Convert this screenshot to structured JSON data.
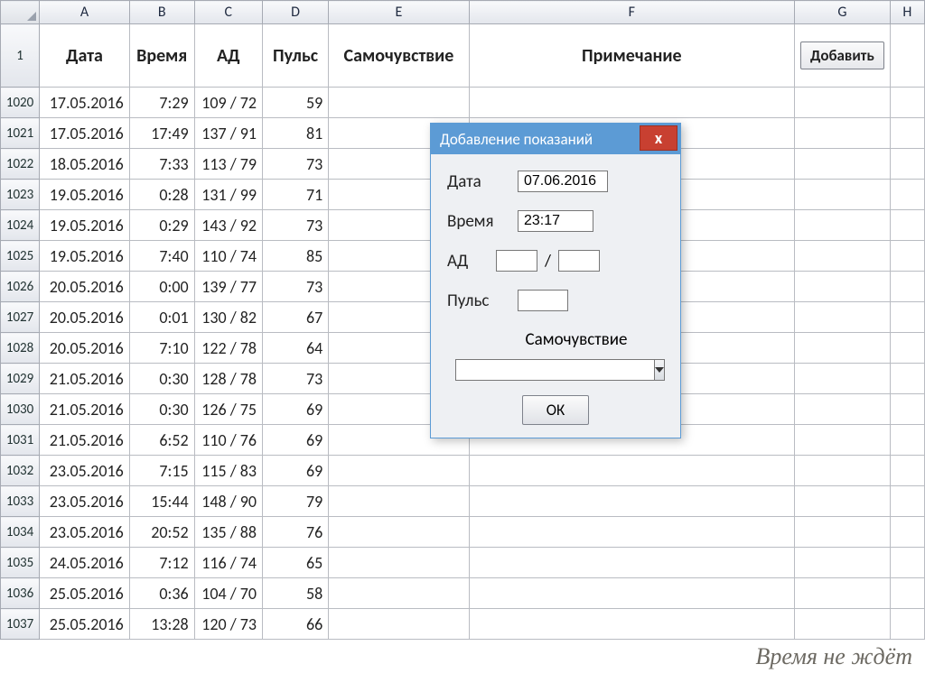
{
  "columns": [
    "A",
    "B",
    "C",
    "D",
    "E",
    "F",
    "G",
    "H"
  ],
  "header_row_num": "1",
  "headers": {
    "A": "Дата",
    "B": "Время",
    "C": "АД",
    "D": "Пульс",
    "E": "Самочувствие",
    "F": "Примечание"
  },
  "add_button": "Добавить",
  "rows": [
    {
      "n": "1020",
      "date": "17.05.2016",
      "time": "7:29",
      "bp": "109 / 72",
      "pulse": "59"
    },
    {
      "n": "1021",
      "date": "17.05.2016",
      "time": "17:49",
      "bp": "137 / 91",
      "pulse": "81"
    },
    {
      "n": "1022",
      "date": "18.05.2016",
      "time": "7:33",
      "bp": "113 / 79",
      "pulse": "73"
    },
    {
      "n": "1023",
      "date": "19.05.2016",
      "time": "0:28",
      "bp": "131 / 99",
      "pulse": "71"
    },
    {
      "n": "1024",
      "date": "19.05.2016",
      "time": "0:29",
      "bp": "143 / 92",
      "pulse": "73"
    },
    {
      "n": "1025",
      "date": "19.05.2016",
      "time": "7:40",
      "bp": "110 / 74",
      "pulse": "85"
    },
    {
      "n": "1026",
      "date": "20.05.2016",
      "time": "0:00",
      "bp": "139 / 77",
      "pulse": "73"
    },
    {
      "n": "1027",
      "date": "20.05.2016",
      "time": "0:01",
      "bp": "130 / 82",
      "pulse": "67"
    },
    {
      "n": "1028",
      "date": "20.05.2016",
      "time": "7:10",
      "bp": "122 / 78",
      "pulse": "64"
    },
    {
      "n": "1029",
      "date": "21.05.2016",
      "time": "0:30",
      "bp": "128 / 78",
      "pulse": "73"
    },
    {
      "n": "1030",
      "date": "21.05.2016",
      "time": "0:30",
      "bp": "126 / 75",
      "pulse": "69"
    },
    {
      "n": "1031",
      "date": "21.05.2016",
      "time": "6:52",
      "bp": "110 / 76",
      "pulse": "69"
    },
    {
      "n": "1032",
      "date": "23.05.2016",
      "time": "7:15",
      "bp": "115 / 83",
      "pulse": "69"
    },
    {
      "n": "1033",
      "date": "23.05.2016",
      "time": "15:44",
      "bp": "148 / 90",
      "pulse": "79"
    },
    {
      "n": "1034",
      "date": "23.05.2016",
      "time": "20:52",
      "bp": "135 / 88",
      "pulse": "76"
    },
    {
      "n": "1035",
      "date": "24.05.2016",
      "time": "7:12",
      "bp": "116 / 74",
      "pulse": "65"
    },
    {
      "n": "1036",
      "date": "25.05.2016",
      "time": "0:36",
      "bp": "104 / 70",
      "pulse": "58"
    },
    {
      "n": "1037",
      "date": "25.05.2016",
      "time": "13:28",
      "bp": "120 / 73",
      "pulse": "66"
    }
  ],
  "dialog": {
    "title": "Добавление показаний",
    "close": "x",
    "fields": {
      "date_label": "Дата",
      "date_value": "07.06.2016",
      "time_label": "Время",
      "time_value": "23:17",
      "bp_label": "АД",
      "bp_sys": "",
      "bp_dia": "",
      "slash": "/",
      "pulse_label": "Пульс",
      "pulse_value": "",
      "feel_label": "Самочувствие",
      "feel_value": ""
    },
    "ok": "ОК"
  },
  "watermark": "Время не ждёт"
}
